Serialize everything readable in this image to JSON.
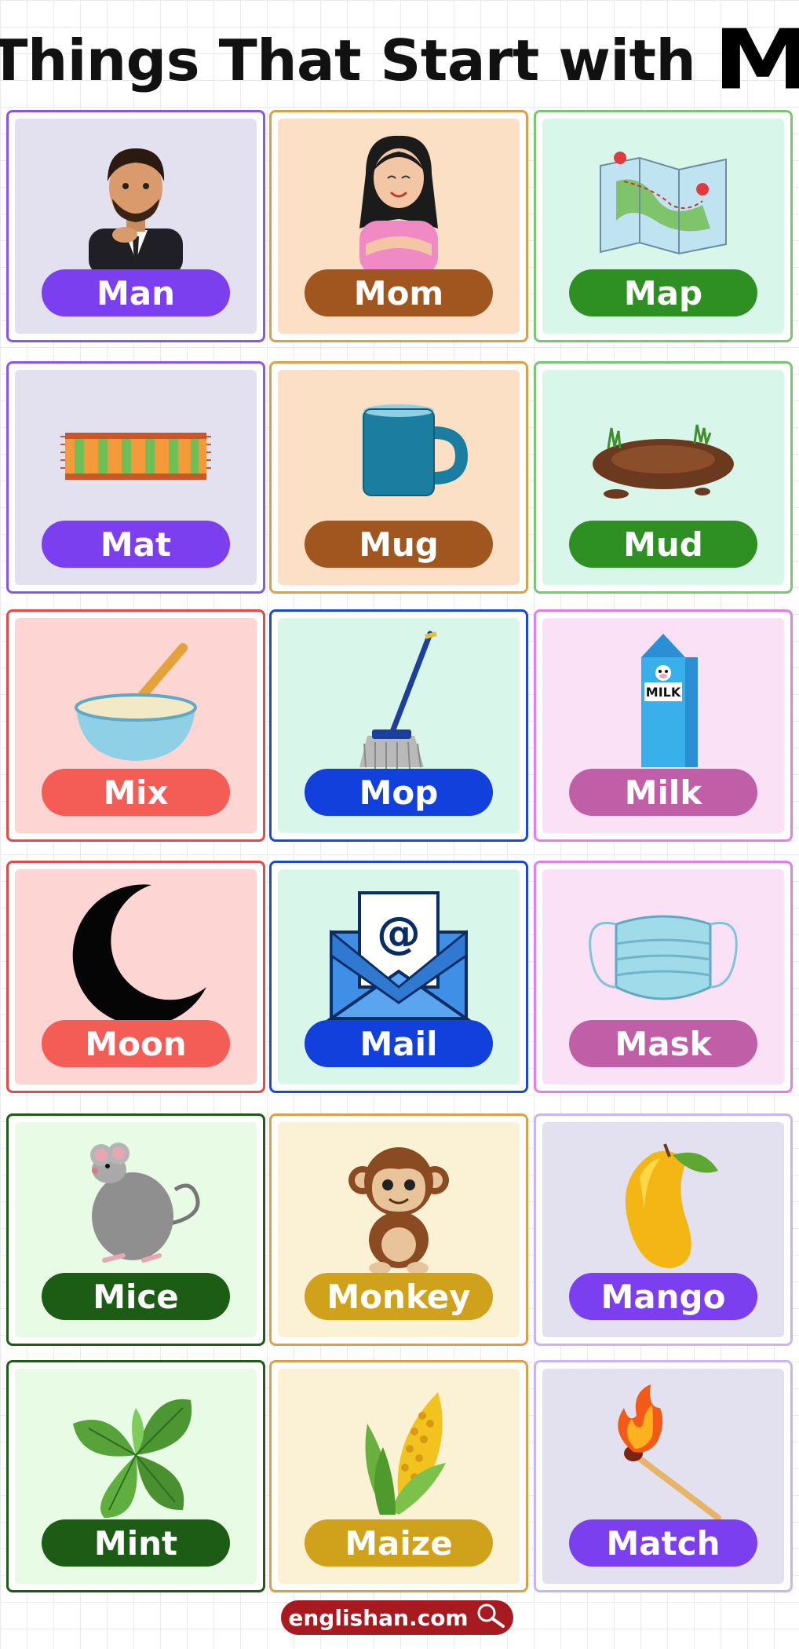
{
  "title": {
    "text": "Things That Start with",
    "letter": "M"
  },
  "footer": {
    "site": "englishan.com",
    "icon": "search-icon"
  },
  "colors": {
    "lavender": "#e3e0f0",
    "peach": "#fbe0c6",
    "mint": "#d9f6ea",
    "pink_red": "#fdd6d4",
    "light_pink": "#fbe1f6",
    "light_green": "#e8fbe4",
    "cream": "#fbf1d4"
  },
  "cards": [
    {
      "label": "Man",
      "icon": "man-icon",
      "border": "#8a55ea",
      "bg": "#e3e0f0",
      "pill": "#7b3ff0"
    },
    {
      "label": "Mom",
      "icon": "mom-icon",
      "border": "#d9a14a",
      "bg": "#fbe0c6",
      "pill": "#a0561e"
    },
    {
      "label": "Map",
      "icon": "map-icon",
      "border": "#7bc675",
      "bg": "#d9f6ea",
      "pill": "#2e8f22"
    },
    {
      "label": "Mat",
      "icon": "mat-icon",
      "border": "#8a55ea",
      "bg": "#e3e0f0",
      "pill": "#7b3ff0"
    },
    {
      "label": "Mug",
      "icon": "mug-icon",
      "border": "#d9a14a",
      "bg": "#fbe0c6",
      "pill": "#a0561e"
    },
    {
      "label": "Mud",
      "icon": "mud-icon",
      "border": "#7bc675",
      "bg": "#d9f6ea",
      "pill": "#2e8f22"
    },
    {
      "label": "Mix",
      "icon": "mix-bowl-icon",
      "border": "#e14a4a",
      "bg": "#fdd6d4",
      "pill": "#f45d55"
    },
    {
      "label": "Mop",
      "icon": "mop-icon",
      "border": "#1c48d6",
      "bg": "#d9f6ea",
      "pill": "#1240dc"
    },
    {
      "label": "Milk",
      "icon": "milk-icon",
      "border": "#e67ee8",
      "bg": "#fbe1f6",
      "pill": "#c15ea8"
    },
    {
      "label": "Moon",
      "icon": "moon-icon",
      "border": "#e14a4a",
      "bg": "#fdd6d4",
      "pill": "#f45d55"
    },
    {
      "label": "Mail",
      "icon": "mail-icon",
      "border": "#1c48d6",
      "bg": "#d9f6ea",
      "pill": "#1240dc"
    },
    {
      "label": "Mask",
      "icon": "mask-icon",
      "border": "#e67ee8",
      "bg": "#fbe1f6",
      "pill": "#c15ea8"
    },
    {
      "label": "Mice",
      "icon": "mouse-icon",
      "border": "#1e5a18",
      "bg": "#e8fbe4",
      "pill": "#1d5c14"
    },
    {
      "label": "Monkey",
      "icon": "monkey-icon",
      "border": "#d9a14a",
      "bg": "#fbf1d4",
      "pill": "#d0a21c"
    },
    {
      "label": "Mango",
      "icon": "mango-icon",
      "border": "#c9b6f0",
      "bg": "#e3e0f0",
      "pill": "#7b3ff0"
    },
    {
      "label": "Mint",
      "icon": "mint-icon",
      "border": "#1e5a18",
      "bg": "#e8fbe4",
      "pill": "#1d5c14"
    },
    {
      "label": "Maize",
      "icon": "maize-icon",
      "border": "#d9a14a",
      "bg": "#fbf1d4",
      "pill": "#d0a21c"
    },
    {
      "label": "Match",
      "icon": "match-icon",
      "border": "#c9b6f0",
      "bg": "#e3e0f0",
      "pill": "#7b3ff0"
    }
  ]
}
